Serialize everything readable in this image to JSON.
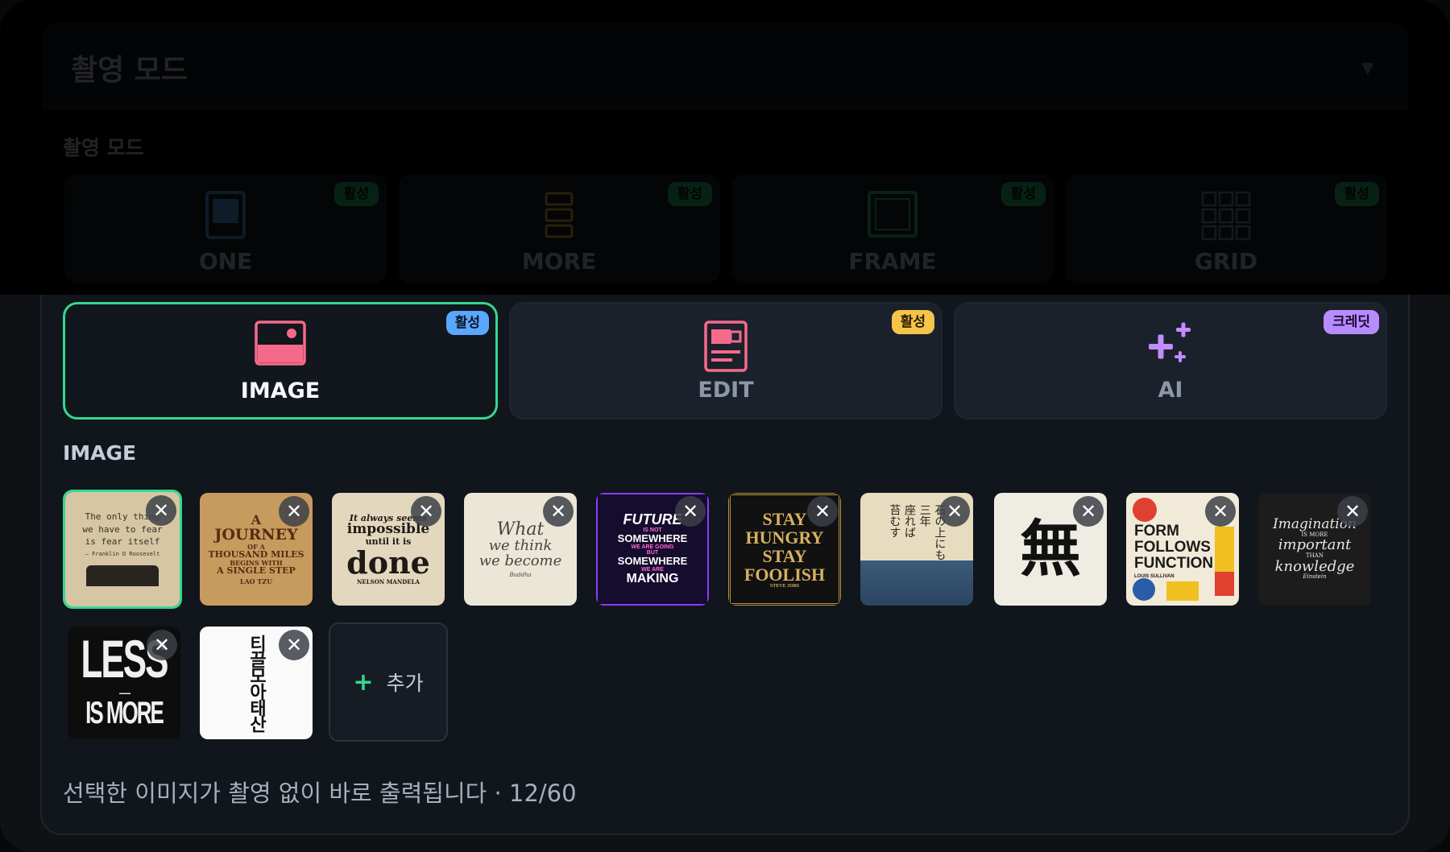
{
  "dropdown": {
    "title": "촬영 모드",
    "caret": "▼"
  },
  "top_section": {
    "label": "촬영 모드",
    "modes": [
      {
        "label": "ONE",
        "badge": "활성"
      },
      {
        "label": "MORE",
        "badge": "활성"
      },
      {
        "label": "FRAME",
        "badge": "활성"
      },
      {
        "label": "GRID",
        "badge": "활성"
      }
    ]
  },
  "modes": [
    {
      "label": "IMAGE",
      "badge": "활성",
      "badge_color": "#5aa7ff",
      "active": true
    },
    {
      "label": "EDIT",
      "badge": "활성",
      "badge_color": "#f7c44a",
      "active": false
    },
    {
      "label": "AI",
      "badge": "크레딧",
      "badge_color": "#b88cff",
      "active": false
    }
  ],
  "image_section": {
    "label": "IMAGE"
  },
  "thumbnails": [
    {
      "lines": [
        "The only thing",
        "we have to fear",
        "is fear itself",
        "— Franklin D Roosevelt"
      ]
    },
    {
      "lines": [
        "A",
        "JOURNEY",
        "OF A",
        "THOUSAND MILES",
        "BEGINS WITH",
        "A SINGLE STEP",
        "LAO TZU"
      ]
    },
    {
      "lines": [
        "It always seems",
        "impossible",
        "until it is",
        "done",
        "NELSON MANDELA"
      ]
    },
    {
      "lines": [
        "What",
        "we think",
        "we become",
        "Buddha"
      ]
    },
    {
      "lines": [
        "FUTURE",
        "IS NOT",
        "SOMEWHERE",
        "WE ARE GOING",
        "BUT",
        "SOMEWHERE",
        "WE ARE",
        "MAKING"
      ]
    },
    {
      "lines": [
        "STAY",
        "HUNGRY",
        "STAY",
        "FOOLISH",
        "STEVE JOBS"
      ]
    },
    {
      "lines": [
        "石の上にも",
        "三年",
        "座れば",
        "苔むす"
      ]
    },
    {
      "lines": [
        "無"
      ]
    },
    {
      "lines": [
        "FORM",
        "FOLLOWS",
        "FUNCTION",
        "LOUIS SULLIVAN"
      ]
    },
    {
      "lines": [
        "Imagination",
        "IS MORE",
        "important",
        "THAN",
        "knowledge",
        "Einstein"
      ]
    },
    {
      "lines": [
        "LESS",
        "—",
        "IS MORE"
      ]
    },
    {
      "lines": [
        "티끌모아",
        "태산"
      ]
    }
  ],
  "close_glyph": "✕",
  "add_button": {
    "plus": "+",
    "label": "추가"
  },
  "footer_text": "선택한 이미지가 촬영 없이 바로 출력됩니다 · 12/60"
}
